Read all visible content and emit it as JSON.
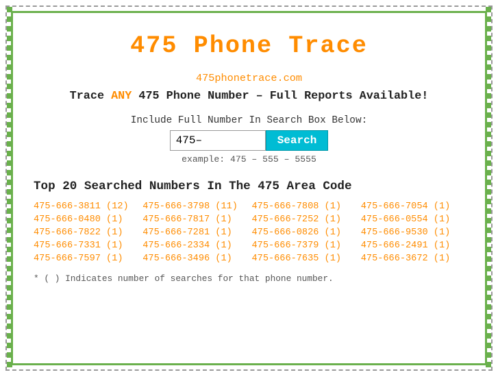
{
  "page": {
    "title": "475 Phone Trace",
    "site_url": "475phonetrace.com",
    "tagline_before": "Trace ",
    "tagline_any": "ANY",
    "tagline_after": " 475 Phone Number – Full Reports Available!",
    "search_label": "Include Full Number In Search Box Below:",
    "search_placeholder": "475–",
    "search_button_label": "Search",
    "search_example": "example: 475 – 555 – 5555",
    "top_numbers_title": "Top 20 Searched Numbers In The 475 Area Code",
    "footnote": "* ( ) Indicates number of searches for that phone number."
  },
  "numbers": [
    {
      "text": "475-666-3811 (12)"
    },
    {
      "text": "475-666-3798 (11)"
    },
    {
      "text": "475-666-7808 (1)"
    },
    {
      "text": "475-666-7054 (1)"
    },
    {
      "text": "475-666-0480 (1)"
    },
    {
      "text": "475-666-7817 (1)"
    },
    {
      "text": "475-666-7252 (1)"
    },
    {
      "text": "475-666-0554 (1)"
    },
    {
      "text": "475-666-7822 (1)"
    },
    {
      "text": "475-666-7281 (1)"
    },
    {
      "text": "475-666-0826 (1)"
    },
    {
      "text": "475-666-9530 (1)"
    },
    {
      "text": "475-666-7331 (1)"
    },
    {
      "text": "475-666-2334 (1)"
    },
    {
      "text": "475-666-7379 (1)"
    },
    {
      "text": "475-666-2491 (1)"
    },
    {
      "text": "475-666-7597 (1)"
    },
    {
      "text": "475-666-3496 (1)"
    },
    {
      "text": "475-666-7635 (1)"
    },
    {
      "text": "475-666-3672 (1)"
    }
  ]
}
